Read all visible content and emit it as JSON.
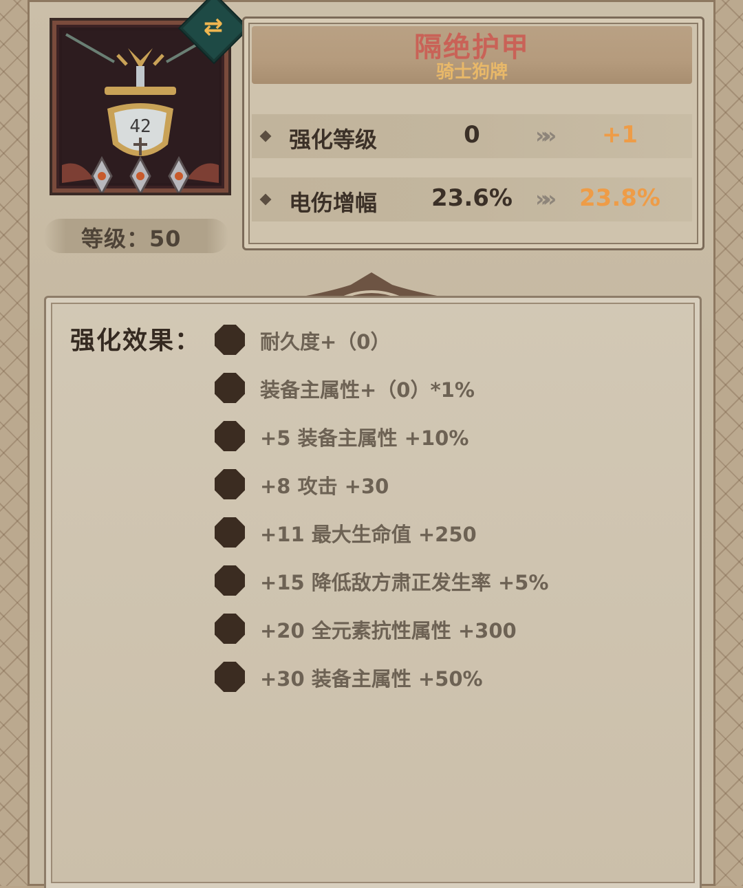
{
  "item": {
    "name": "隔绝护甲",
    "type": "骑士狗牌",
    "level_label": "等级：50",
    "plaque_text": "42"
  },
  "stats": [
    {
      "name": "强化等级",
      "current": "0",
      "next": "+1"
    },
    {
      "name": "电伤增幅",
      "current": "23.6%",
      "next": "23.8%"
    }
  ],
  "effects": {
    "heading": "强化效果：",
    "items": [
      "耐久度+（0）",
      "装备主属性+（0）*1%",
      "+5  装备主属性 +10%",
      "+8  攻击 +30",
      "+11  最大生命值 +250",
      "+15  降低敌方肃正发生率 +5%",
      "+20  全元素抗性属性 +300",
      "+30  装备主属性 +50%"
    ]
  },
  "colors": {
    "item_name": "#c96257",
    "item_type": "#e8b869",
    "upgrade_value": "#ee9c47",
    "bullet": "#3b2c21"
  },
  "icons": {
    "swap": "swap-arrows-icon",
    "stat_marker": "diamond-icon",
    "upgrade_arrow": "double-chevron-right-icon"
  }
}
